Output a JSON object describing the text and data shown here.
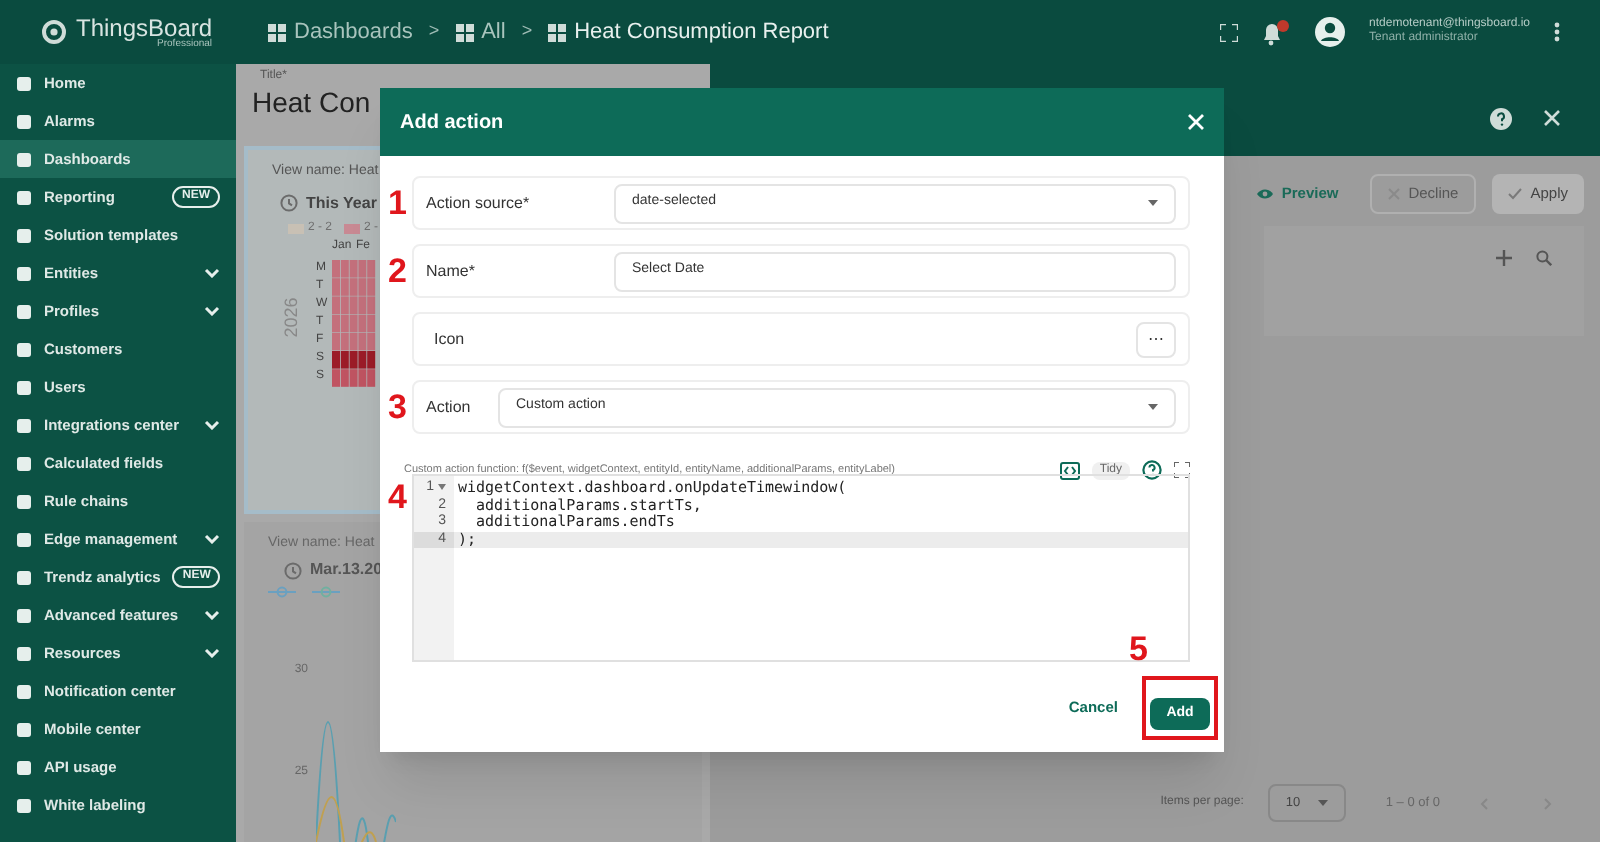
{
  "app": {
    "logo": "ThingsBoard",
    "edition": "Professional"
  },
  "breadcrumbs": {
    "separator": ">",
    "items": [
      {
        "label": "Dashboards"
      },
      {
        "label": "All"
      },
      {
        "label": "Heat Consumption Report"
      }
    ]
  },
  "user": {
    "email": "ntdemotenant@thingsboard.io",
    "role": "Tenant administrator"
  },
  "sidebar": {
    "items": [
      {
        "label": "Home",
        "selected": false,
        "expandable": false
      },
      {
        "label": "Alarms",
        "selected": false,
        "expandable": false
      },
      {
        "label": "Dashboards",
        "selected": true,
        "expandable": false
      },
      {
        "label": "Reporting",
        "selected": false,
        "expandable": false,
        "badge": "NEW"
      },
      {
        "label": "Solution templates",
        "selected": false,
        "expandable": false
      },
      {
        "label": "Entities",
        "selected": false,
        "expandable": true
      },
      {
        "label": "Profiles",
        "selected": false,
        "expandable": true
      },
      {
        "label": "Customers",
        "selected": false,
        "expandable": false
      },
      {
        "label": "Users",
        "selected": false,
        "expandable": false
      },
      {
        "label": "Integrations center",
        "selected": false,
        "expandable": true
      },
      {
        "label": "Calculated fields",
        "selected": false,
        "expandable": false
      },
      {
        "label": "Rule chains",
        "selected": false,
        "expandable": false
      },
      {
        "label": "Edge management",
        "selected": false,
        "expandable": true
      },
      {
        "label": "Trendz analytics",
        "selected": false,
        "expandable": false,
        "badge": "NEW"
      },
      {
        "label": "Advanced features",
        "selected": false,
        "expandable": true
      },
      {
        "label": "Resources",
        "selected": false,
        "expandable": true
      },
      {
        "label": "Notification center",
        "selected": false,
        "expandable": false
      },
      {
        "label": "Mobile center",
        "selected": false,
        "expandable": false
      },
      {
        "label": "API usage",
        "selected": false,
        "expandable": false
      },
      {
        "label": "White labeling",
        "selected": false,
        "expandable": false
      }
    ]
  },
  "editor": {
    "title_label": "Title*",
    "title": "Heat Con",
    "calendar_widget": {
      "view_name": "View name: Heat",
      "timewindow": "This Year",
      "legend": [
        "2 - 2",
        "2 -"
      ],
      "months": [
        "Jan",
        "Fe"
      ],
      "year": "2026",
      "days": [
        "M",
        "T",
        "W",
        "T",
        "F",
        "S",
        "S"
      ]
    },
    "line_widget": {
      "view_name": "View name: Heat",
      "timewindow": "Mar.13.20",
      "yticks": [
        "30",
        "25"
      ]
    }
  },
  "panel": {
    "buttons": [
      {
        "kind": "preview",
        "label": "Preview"
      },
      {
        "kind": "decline",
        "label": "Decline"
      },
      {
        "kind": "apply",
        "label": "Apply"
      }
    ],
    "items_per_page_label": "Items per page:",
    "items_per_page": "10",
    "range": "1 – 0 of 0"
  },
  "dialog": {
    "title": "Add action",
    "rows": [
      {
        "kind": "select",
        "marker": "1",
        "label": "Action source*",
        "value": "date-selected"
      },
      {
        "kind": "input",
        "marker": "2",
        "label": "Name*",
        "value": "Select Date"
      },
      {
        "kind": "icon",
        "label": "Icon",
        "button": "⋯"
      },
      {
        "kind": "select",
        "marker": "3",
        "label": "Action",
        "value": "Custom action"
      }
    ],
    "code": {
      "marker": "4",
      "label": "Custom action function: f($event, widgetContext, entityId, entityName, additionalParams, entityLabel)",
      "tidy": "Tidy",
      "lines": [
        {
          "number": "1",
          "text": "widgetContext.dashboard.onUpdateTimewindow(",
          "active": false,
          "foldable": true
        },
        {
          "number": "2",
          "text": "  additionalParams.startTs,",
          "active": false,
          "foldable": false
        },
        {
          "number": "3",
          "text": "  additionalParams.endTs",
          "active": false,
          "foldable": false
        },
        {
          "number": "4",
          "text": ");",
          "active": true,
          "foldable": false
        }
      ]
    },
    "cancel": "Cancel",
    "add": {
      "label": "Add",
      "marker": "5",
      "highlighted": true
    }
  }
}
